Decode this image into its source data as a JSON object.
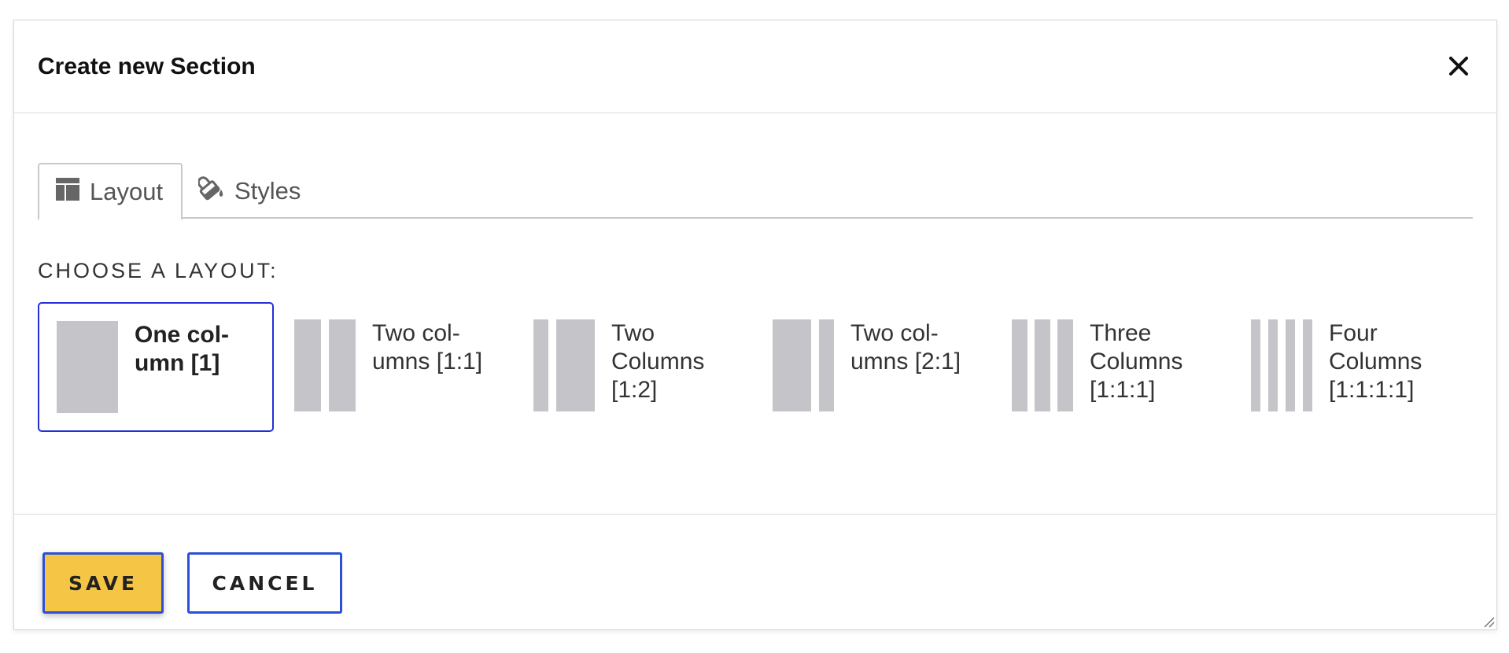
{
  "dialog": {
    "title": "Create new Section",
    "close_icon": "close-icon"
  },
  "tabs": [
    {
      "label": "Layout",
      "icon": "layout-icon",
      "active": true
    },
    {
      "label": "Styles",
      "icon": "paint-bucket-icon",
      "active": false
    }
  ],
  "choose_label": "CHOOSE A LAYOUT:",
  "layouts": [
    {
      "label": "One col-umn [1]",
      "selected": true
    },
    {
      "label": "Two col-umns [1:1]",
      "selected": false
    },
    {
      "label": "Two Columns [1:2]",
      "selected": false
    },
    {
      "label": "Two col-umns [2:1]",
      "selected": false
    },
    {
      "label": "Three Columns [1:1:1]",
      "selected": false
    },
    {
      "label": "Four Columns [1:1:1:1]",
      "selected": false
    }
  ],
  "buttons": {
    "save_label": "SAVE",
    "cancel_label": "CANCEL"
  },
  "colors": {
    "accent_border": "#2b50d6",
    "save_bg": "#f5c645",
    "selected_border": "#2430d6",
    "thumb_gray": "#c5c4c8"
  }
}
